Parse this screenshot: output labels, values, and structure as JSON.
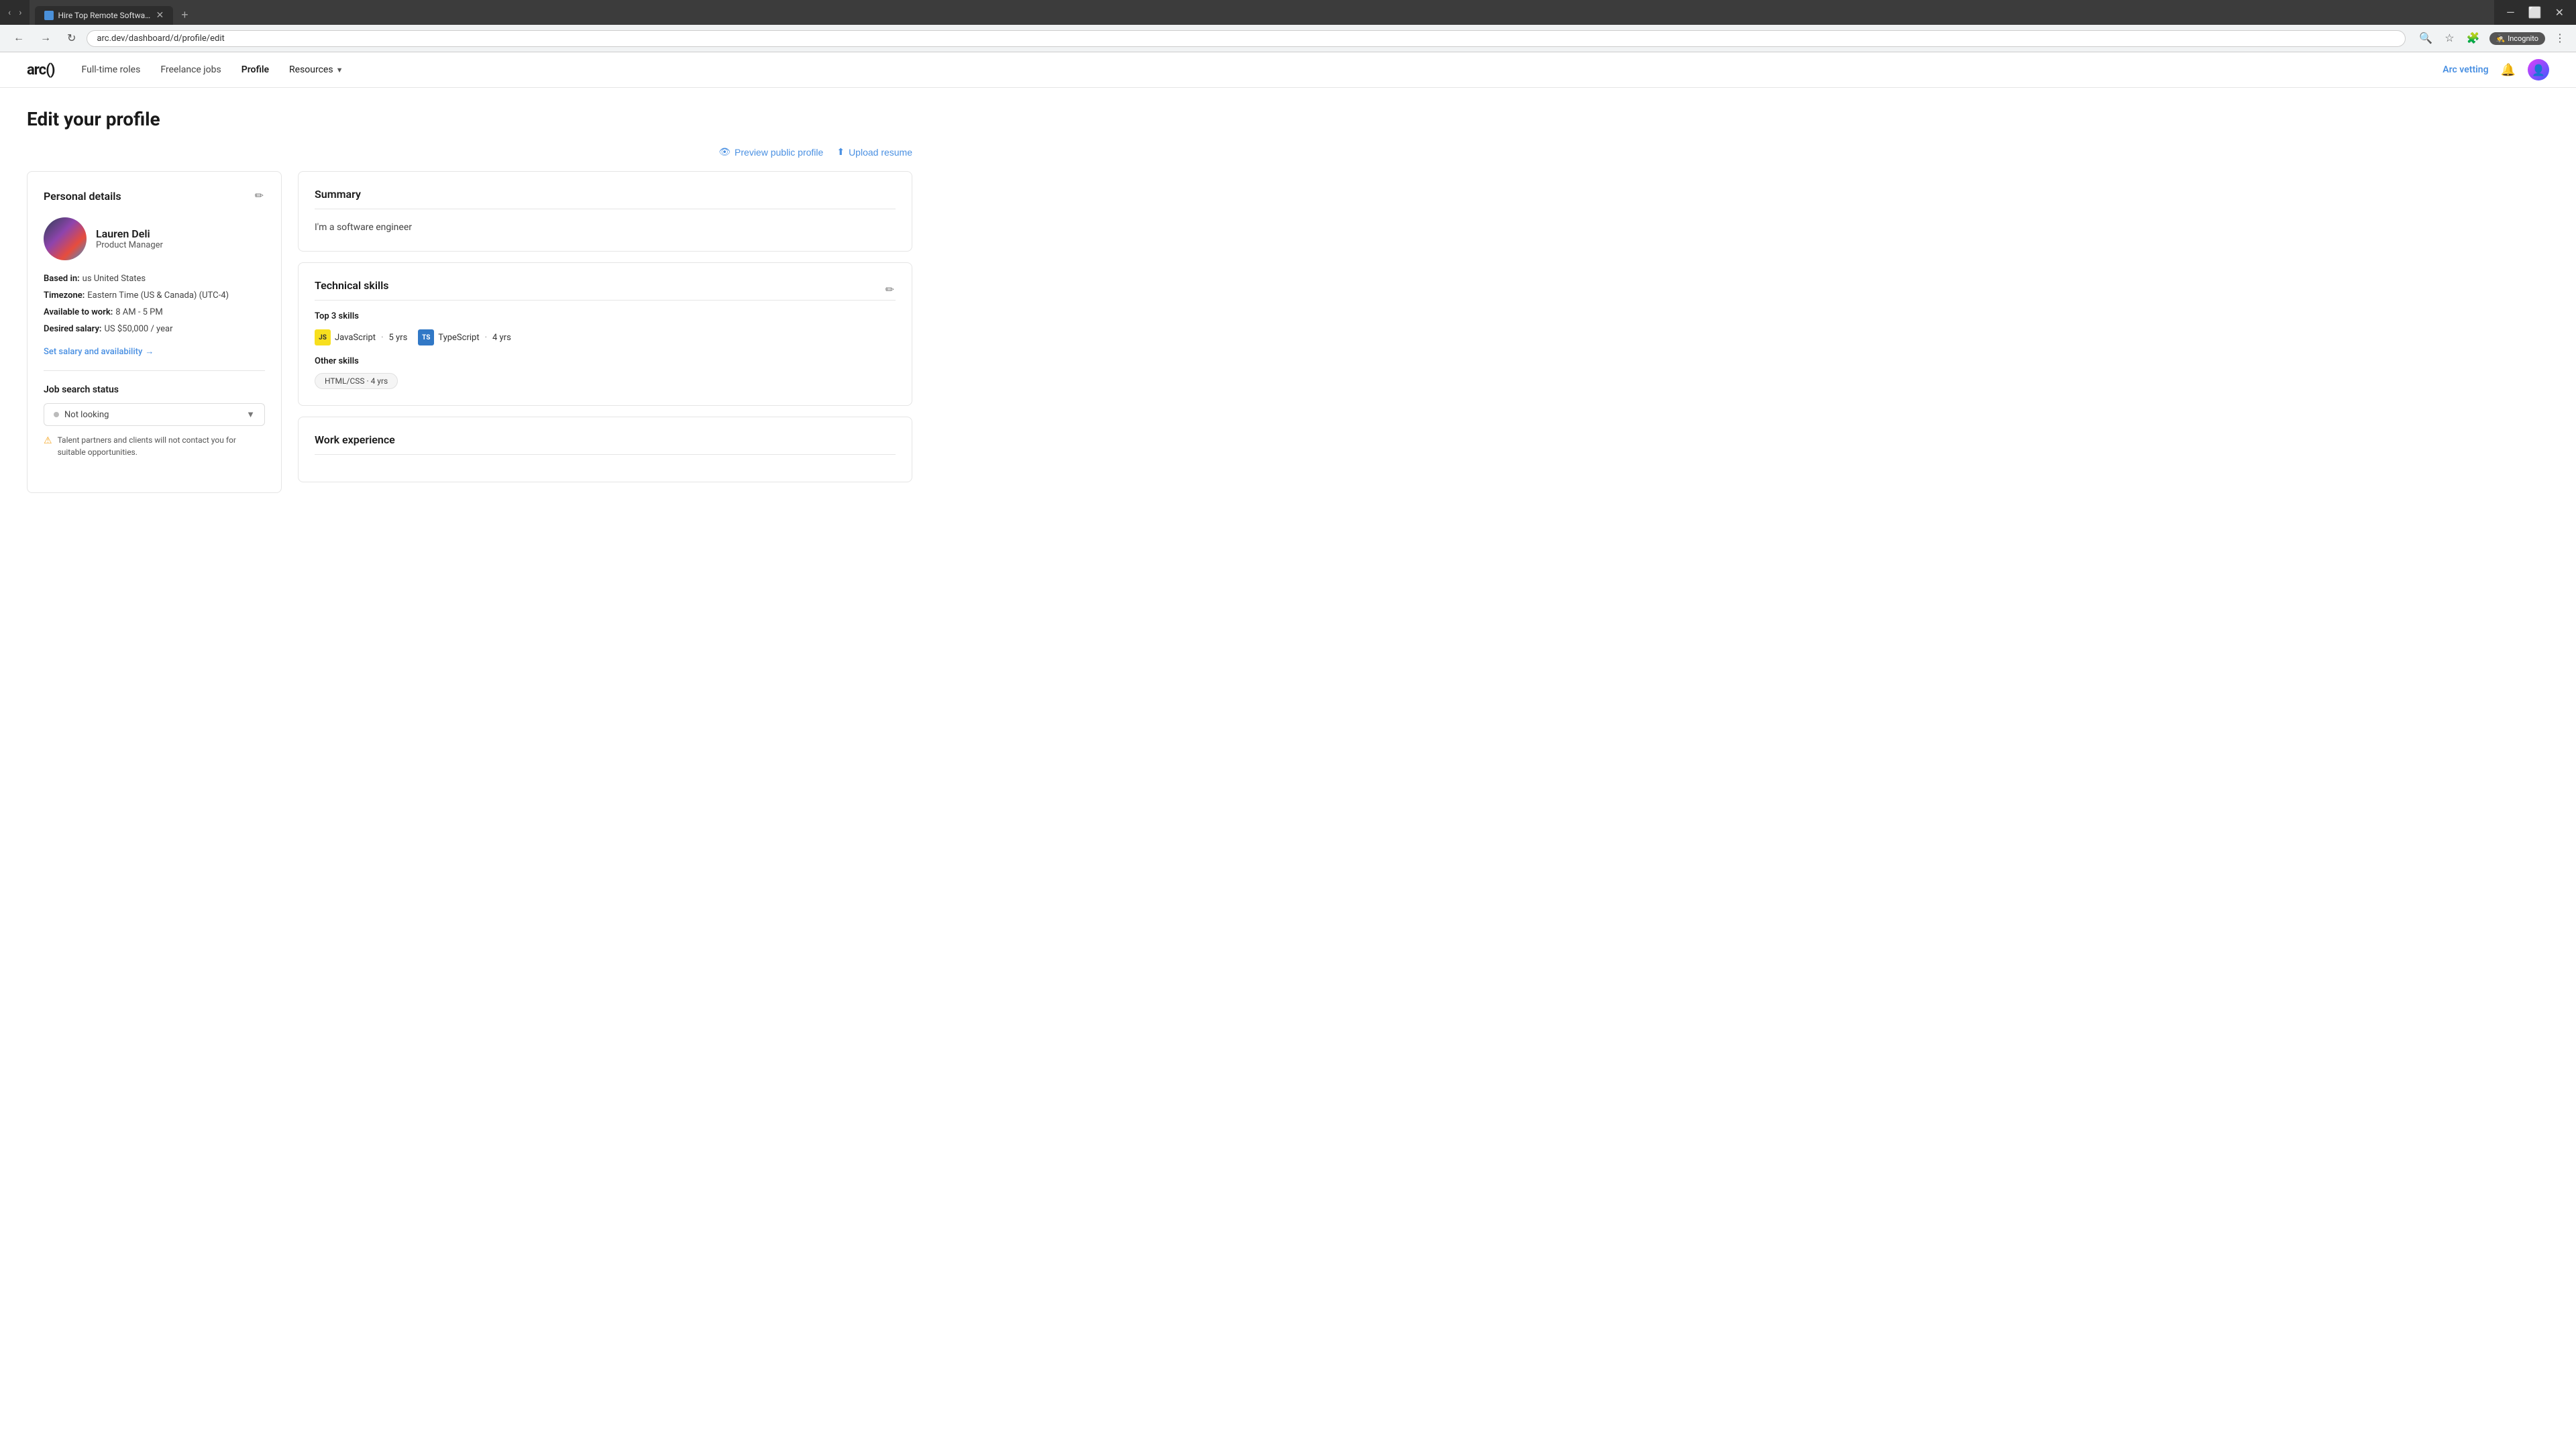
{
  "browser": {
    "tab": {
      "label": "Hire Top Remote Software Dev...",
      "favicon_color": "#4a90d9"
    },
    "url": "arc.dev/dashboard/d/profile/edit",
    "window_controls": {
      "minimize": "—",
      "maximize": "⬜",
      "close": "✕"
    },
    "nav_buttons": {
      "back": "←",
      "forward": "→",
      "refresh": "↻"
    },
    "incognito_label": "Incognito"
  },
  "app_nav": {
    "logo": "arc()",
    "links": [
      {
        "label": "Full-time roles",
        "active": false
      },
      {
        "label": "Freelance jobs",
        "active": false
      },
      {
        "label": "Profile",
        "active": true
      },
      {
        "label": "Resources",
        "active": false
      }
    ],
    "arc_vetting": "Arc vetting"
  },
  "page": {
    "title": "Edit your profile"
  },
  "profile_actions": {
    "preview_label": "Preview public profile",
    "upload_label": "Upload resume",
    "eye_icon": "👁",
    "upload_icon": "⬆"
  },
  "personal_details": {
    "section_title": "Personal details",
    "user": {
      "name": "Lauren Deli",
      "title": "Product Manager"
    },
    "based_in_label": "Based in:",
    "based_in_value": "us United States",
    "timezone_label": "Timezone:",
    "timezone_value": "Eastern Time (US & Canada) (UTC-4)",
    "available_label": "Available to work:",
    "available_value": "8 AM - 5 PM",
    "salary_label": "Desired salary:",
    "salary_value": "US $50,000 / year",
    "set_salary_link": "Set salary and availability",
    "job_search_label": "Job search status",
    "status_value": "Not looking",
    "warning_text": "Talent partners and clients will not contact you for suitable opportunities."
  },
  "summary": {
    "section_title": "Summary",
    "text": "I'm a software engineer"
  },
  "technical_skills": {
    "section_title": "Technical skills",
    "top_skills_label": "Top 3 skills",
    "top_skills": [
      {
        "name": "JavaScript",
        "years": "5 yrs",
        "icon_label": "JS",
        "icon_type": "js"
      },
      {
        "name": "TypeScript",
        "years": "4 yrs",
        "icon_label": "TS",
        "icon_type": "ts"
      }
    ],
    "other_skills_label": "Other skills",
    "other_skills": [
      {
        "name": "HTML/CSS",
        "years": "4 yrs"
      }
    ]
  },
  "work_experience": {
    "section_title": "Work experience"
  }
}
